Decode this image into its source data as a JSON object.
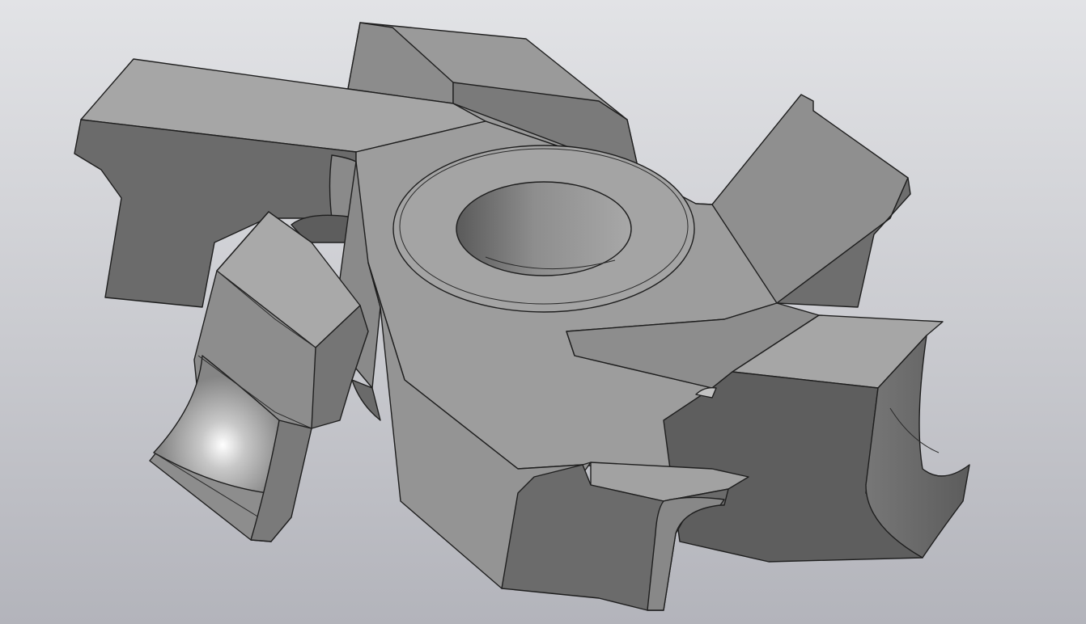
{
  "viewport": {
    "background_top": "#e2e3e6",
    "background_bottom": "#b3b4bb"
  },
  "model": {
    "part_type": "six-blade cutter",
    "blade_count": 6,
    "face_colors": {
      "light": "#a2a2a2",
      "mid": "#8a8a8a",
      "dark": "#6a6a6a",
      "darker": "#5a5a5a",
      "bore": "#7c7c7c",
      "edge": "#1e1e1e"
    }
  }
}
